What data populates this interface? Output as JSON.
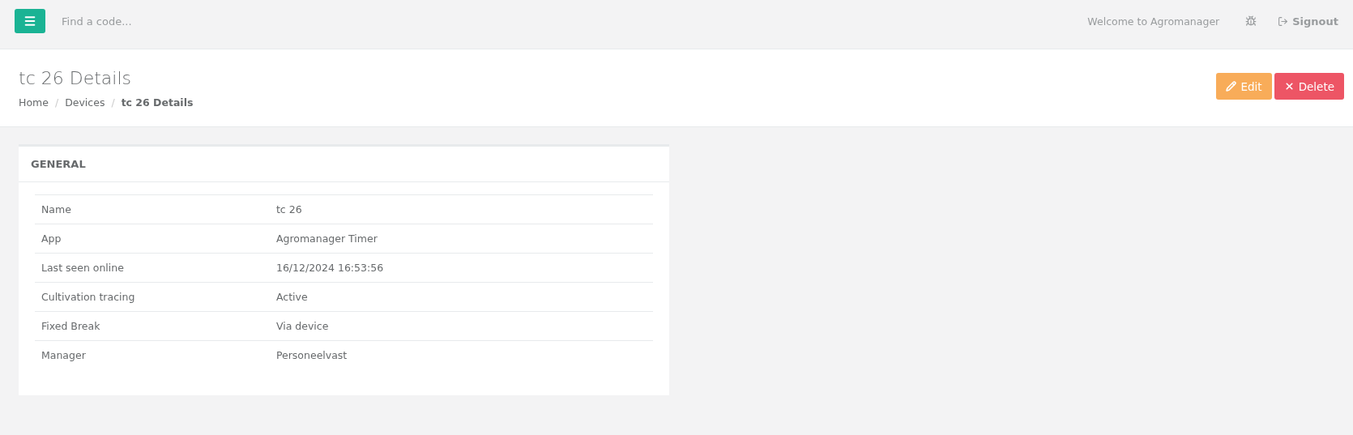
{
  "topbar": {
    "search": {
      "placeholder": "Find a code..."
    },
    "welcome": "Welcome to Agromanager",
    "signout": "Signout"
  },
  "header": {
    "title": "tc 26 Details",
    "breadcrumb_separator": "/",
    "breadcrumb": [
      {
        "label": "Home",
        "current": false
      },
      {
        "label": "Devices",
        "current": false
      },
      {
        "label": "tc 26 Details",
        "current": true
      }
    ],
    "actions": [
      {
        "kind": "edit",
        "label": "Edit"
      },
      {
        "kind": "delete",
        "label": "Delete"
      }
    ]
  },
  "card": {
    "title": "GENERAL",
    "rows": [
      {
        "label": "Name",
        "value": "tc 26"
      },
      {
        "label": "App",
        "value": "Agromanager Timer"
      },
      {
        "label": "Last seen online",
        "value": "16/12/2024 16:53:56"
      },
      {
        "label": "Cultivation tracing",
        "value": "Active"
      },
      {
        "label": "Fixed Break",
        "value": "Via device"
      },
      {
        "label": "Manager",
        "value": "Personeelvast"
      }
    ]
  }
}
